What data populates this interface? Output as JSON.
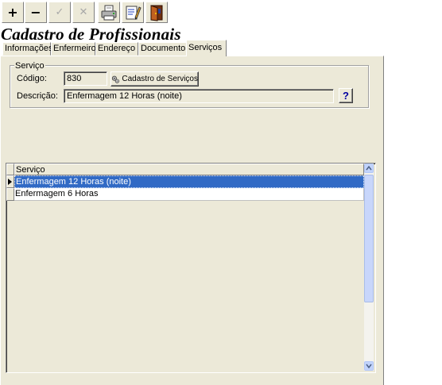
{
  "toolbar": {
    "add_label": "+",
    "remove_label": "−",
    "confirm_label": "✓",
    "cancel_label": "✕",
    "print_icon": "printer-icon",
    "edit_icon": "notepad-pencil-icon",
    "exit_icon": "exit-door-icon"
  },
  "form_title": "Cadastro de Profissionais",
  "tabs": [
    {
      "label": "Informações"
    },
    {
      "label": "Enfermeiro"
    },
    {
      "label": "Endereço"
    },
    {
      "label": "Documento"
    },
    {
      "label": "Serviços",
      "active": true
    }
  ],
  "servico_group": {
    "caption": "Serviço",
    "codigo_label": "Código:",
    "codigo_value": "830",
    "cadastro_button_label": "Cadastro de Serviços",
    "descricao_label": "Descrição:",
    "descricao_value": "Enfermagem 12 Horas (noite)",
    "help_button_label": "?"
  },
  "grid": {
    "column_header": "Serviço",
    "rows": [
      {
        "servico": "Enfermagem 12 Horas (noite)",
        "selected": true
      },
      {
        "servico": "Enfermagem 6 Horas",
        "selected": false
      }
    ]
  },
  "colors": {
    "face": "#ece9d8",
    "selection": "#316ac5",
    "help_blue": "#0000a0"
  }
}
